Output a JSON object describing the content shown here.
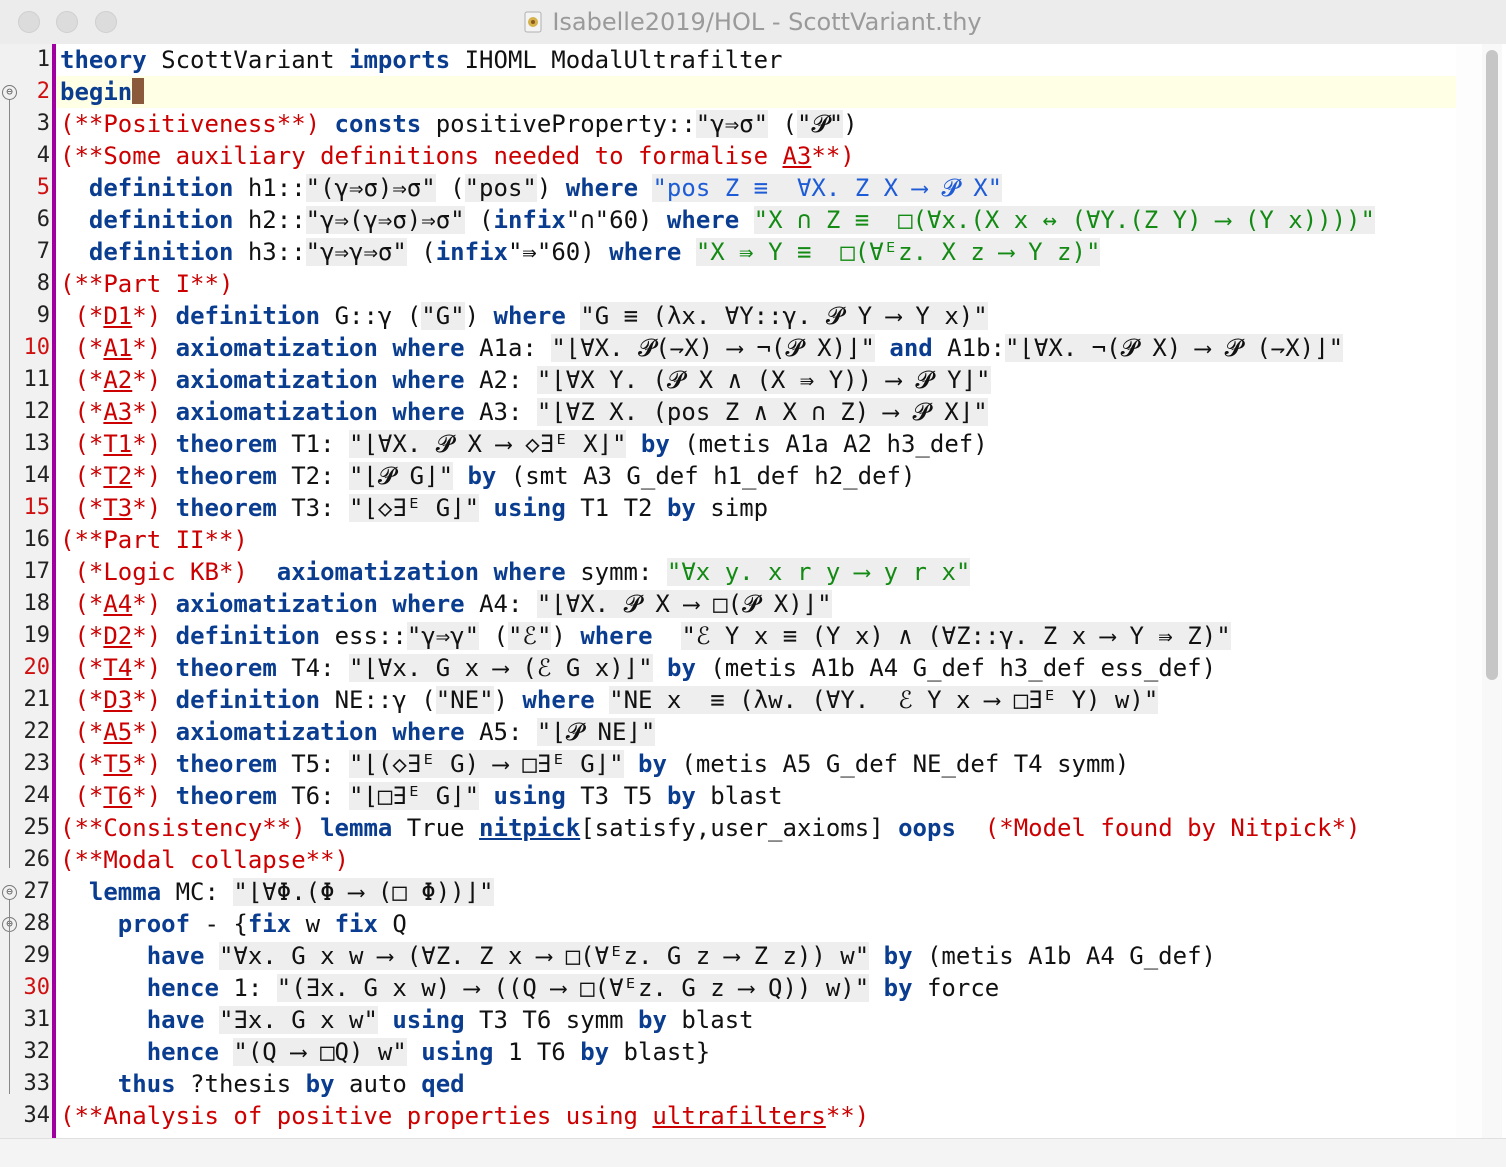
{
  "window": {
    "title": "Isabelle2019/HOL - ScottVariant.thy",
    "buttons": [
      "close",
      "minimize",
      "zoom"
    ]
  },
  "editor": {
    "current_line": 2,
    "lines": [
      {
        "n": "1",
        "segs": [
          [
            "theory",
            "kw"
          ],
          [
            " ScottVariant ",
            ""
          ],
          [
            "imports",
            "kw"
          ],
          [
            " IHOML ModalUltrafilter",
            ""
          ]
        ]
      },
      {
        "n": "2",
        "segs": [
          [
            "begin",
            "kw"
          ]
        ],
        "cursor": true,
        "hl": true,
        "fold": "⊖",
        "numRed": true
      },
      {
        "n": "3",
        "segs": [
          [
            "(**Positiveness**)",
            "cm"
          ],
          [
            " ",
            ""
          ],
          [
            "consts",
            "kw"
          ],
          [
            " positiveProperty::",
            ""
          ],
          [
            "\"γ⇒σ\"",
            "qs"
          ],
          [
            " (",
            ""
          ],
          [
            "\"𝓟\"",
            "qs"
          ],
          [
            ")",
            ""
          ]
        ]
      },
      {
        "n": "4",
        "segs": [
          [
            "(**Some auxiliary definitions needed to formalise ",
            "cm"
          ],
          [
            "A3",
            "cm ul"
          ],
          [
            "**)",
            "cm"
          ]
        ]
      },
      {
        "n": "5",
        "numRed": true,
        "segs": [
          [
            "  ",
            ""
          ],
          [
            "definition",
            "kw"
          ],
          [
            " h1::",
            ""
          ],
          [
            "\"(γ⇒σ)⇒σ\"",
            "qs"
          ],
          [
            " (",
            ""
          ],
          [
            "\"pos\"",
            "qs"
          ],
          [
            ") ",
            ""
          ],
          [
            "where",
            "kw"
          ],
          [
            " ",
            ""
          ],
          [
            "\"pos Z ≡  ∀X. Z X ⟶ 𝓟 X\"",
            "qs bl"
          ]
        ]
      },
      {
        "n": "6",
        "segs": [
          [
            "  ",
            ""
          ],
          [
            "definition",
            "kw"
          ],
          [
            " h2::",
            ""
          ],
          [
            "\"γ⇒(γ⇒σ)⇒σ\"",
            "qs"
          ],
          [
            " (",
            ""
          ],
          [
            "infix",
            "kw"
          ],
          [
            "\"∩\"60) ",
            ""
          ],
          [
            "where",
            "kw"
          ],
          [
            " ",
            ""
          ],
          [
            "\"X ∩ Z ≡  □(∀x.(X x ↔ (∀Y.(Z Y) ⟶ (Y x))))\"",
            "qs gr"
          ]
        ]
      },
      {
        "n": "7",
        "segs": [
          [
            "  ",
            ""
          ],
          [
            "definition",
            "kw"
          ],
          [
            " h3::",
            ""
          ],
          [
            "\"γ⇒γ⇒σ\"",
            "qs"
          ],
          [
            " (",
            ""
          ],
          [
            "infix",
            "kw"
          ],
          [
            "\"⇛\"60) ",
            ""
          ],
          [
            "where",
            "kw"
          ],
          [
            " ",
            ""
          ],
          [
            "\"X ⇛ Y ≡  □(∀ᴱz. X z ⟶ Y z)\"",
            "qs gr"
          ]
        ]
      },
      {
        "n": "8",
        "segs": [
          [
            "(**Part I**)",
            "cm"
          ]
        ]
      },
      {
        "n": "9",
        "segs": [
          [
            " (*",
            "cm"
          ],
          [
            "D1",
            "cm ul"
          ],
          [
            "*) ",
            "cm"
          ],
          [
            "definition",
            "kw"
          ],
          [
            " G::γ (",
            ""
          ],
          [
            "\"G\"",
            "qs"
          ],
          [
            ") ",
            ""
          ],
          [
            "where",
            "kw"
          ],
          [
            " ",
            ""
          ],
          [
            "\"G ≡ (λx. ∀Y::γ. 𝓟 Y ⟶ Y x)\"",
            "qs"
          ]
        ]
      },
      {
        "n": "10",
        "numRed": true,
        "segs": [
          [
            " (*",
            "cm"
          ],
          [
            "A1",
            "cm ul"
          ],
          [
            "*) ",
            "cm"
          ],
          [
            "axiomatization",
            "kw"
          ],
          [
            " ",
            ""
          ],
          [
            "where",
            "kw"
          ],
          [
            " A1a: ",
            ""
          ],
          [
            "\"⌊∀X. 𝓟(⇁X) ⟶ ¬(𝓟 X)⌋\"",
            "qs"
          ],
          [
            " ",
            ""
          ],
          [
            "and",
            "kw"
          ],
          [
            " A1b:",
            ""
          ],
          [
            "\"⌊∀X. ¬(𝓟 X) ⟶ 𝓟 (⇁X)⌋\"",
            "qs"
          ]
        ]
      },
      {
        "n": "11",
        "segs": [
          [
            " (*",
            "cm"
          ],
          [
            "A2",
            "cm ul"
          ],
          [
            "*) ",
            "cm"
          ],
          [
            "axiomatization",
            "kw"
          ],
          [
            " ",
            ""
          ],
          [
            "where",
            "kw"
          ],
          [
            " A2: ",
            ""
          ],
          [
            "\"⌊∀X Y. (𝓟 X ∧ (X ⇛ Y)) ⟶ 𝓟 Y⌋\"",
            "qs"
          ]
        ]
      },
      {
        "n": "12",
        "segs": [
          [
            " (*",
            "cm"
          ],
          [
            "A3",
            "cm ul"
          ],
          [
            "*) ",
            "cm"
          ],
          [
            "axiomatization",
            "kw"
          ],
          [
            " ",
            ""
          ],
          [
            "where",
            "kw"
          ],
          [
            " A3: ",
            ""
          ],
          [
            "\"⌊∀Z X. (pos Z ∧ X ∩ Z) ⟶ 𝓟 X⌋\"",
            "qs"
          ]
        ]
      },
      {
        "n": "13",
        "segs": [
          [
            " (*",
            "cm"
          ],
          [
            "T1",
            "cm ul"
          ],
          [
            "*) ",
            "cm"
          ],
          [
            "theorem",
            "kw"
          ],
          [
            " T1: ",
            ""
          ],
          [
            "\"⌊∀X. 𝓟 X ⟶ ◇∃ᴱ X⌋\"",
            "qs"
          ],
          [
            " ",
            ""
          ],
          [
            "by",
            "kw"
          ],
          [
            " (metis A1a A2 h3_def)",
            ""
          ]
        ]
      },
      {
        "n": "14",
        "segs": [
          [
            " (*",
            "cm"
          ],
          [
            "T2",
            "cm ul"
          ],
          [
            "*) ",
            "cm"
          ],
          [
            "theorem",
            "kw"
          ],
          [
            " T2: ",
            ""
          ],
          [
            "\"⌊𝓟 G⌋\"",
            "qs"
          ],
          [
            " ",
            ""
          ],
          [
            "by",
            "kw"
          ],
          [
            " (smt A3 G_def h1_def h2_def)",
            ""
          ]
        ]
      },
      {
        "n": "15",
        "numRed": true,
        "segs": [
          [
            " (*",
            "cm"
          ],
          [
            "T3",
            "cm ul"
          ],
          [
            "*) ",
            "cm"
          ],
          [
            "theorem",
            "kw"
          ],
          [
            " T3: ",
            ""
          ],
          [
            "\"⌊◇∃ᴱ G⌋\"",
            "qs"
          ],
          [
            " ",
            ""
          ],
          [
            "using",
            "kw"
          ],
          [
            " T1 T2 ",
            ""
          ],
          [
            "by",
            "kw"
          ],
          [
            " simp",
            ""
          ]
        ]
      },
      {
        "n": "16",
        "segs": [
          [
            "(**Part II**)",
            "cm"
          ]
        ]
      },
      {
        "n": "17",
        "segs": [
          [
            " (*Logic KB*)  ",
            "cm"
          ],
          [
            "axiomatization",
            "kw"
          ],
          [
            " ",
            ""
          ],
          [
            "where",
            "kw"
          ],
          [
            " symm: ",
            ""
          ],
          [
            "\"∀x y. x r y ⟶ y r x\"",
            "qs gr"
          ]
        ]
      },
      {
        "n": "18",
        "segs": [
          [
            " (*",
            "cm"
          ],
          [
            "A4",
            "cm ul"
          ],
          [
            "*) ",
            "cm"
          ],
          [
            "axiomatization",
            "kw"
          ],
          [
            " ",
            ""
          ],
          [
            "where",
            "kw"
          ],
          [
            " A4: ",
            ""
          ],
          [
            "\"⌊∀X. 𝓟 X ⟶ □(𝓟 X)⌋\"",
            "qs"
          ]
        ]
      },
      {
        "n": "19",
        "segs": [
          [
            " (*",
            "cm"
          ],
          [
            "D2",
            "cm ul"
          ],
          [
            "*) ",
            "cm"
          ],
          [
            "definition",
            "kw"
          ],
          [
            " ess::",
            ""
          ],
          [
            "\"γ⇒γ\"",
            "qs"
          ],
          [
            " (",
            ""
          ],
          [
            "\"ℰ\"",
            "qs"
          ],
          [
            ") ",
            ""
          ],
          [
            "where",
            "kw"
          ],
          [
            "  ",
            ""
          ],
          [
            "\"ℰ Y x ≡ (Y x) ∧ (∀Z::γ. Z x ⟶ Y ⇛ Z)\"",
            "qs"
          ]
        ]
      },
      {
        "n": "20",
        "numRed": true,
        "segs": [
          [
            " (*",
            "cm"
          ],
          [
            "T4",
            "cm ul"
          ],
          [
            "*) ",
            "cm"
          ],
          [
            "theorem",
            "kw"
          ],
          [
            " T4: ",
            ""
          ],
          [
            "\"⌊∀x. G x ⟶ (ℰ G x)⌋\"",
            "qs"
          ],
          [
            " ",
            ""
          ],
          [
            "by",
            "kw"
          ],
          [
            " (metis A1b A4 G_def h3_def ess_def)",
            ""
          ]
        ]
      },
      {
        "n": "21",
        "segs": [
          [
            " (*",
            "cm"
          ],
          [
            "D3",
            "cm ul"
          ],
          [
            "*) ",
            "cm"
          ],
          [
            "definition",
            "kw"
          ],
          [
            " NE::γ (",
            ""
          ],
          [
            "\"NE\"",
            "qs"
          ],
          [
            ") ",
            ""
          ],
          [
            "where",
            "kw"
          ],
          [
            " ",
            ""
          ],
          [
            "\"NE x  ≡ (λw. (∀Y.  ℰ Y x ⟶ □∃ᴱ Y) w)\"",
            "qs"
          ]
        ]
      },
      {
        "n": "22",
        "segs": [
          [
            " (*",
            "cm"
          ],
          [
            "A5",
            "cm ul"
          ],
          [
            "*) ",
            "cm"
          ],
          [
            "axiomatization",
            "kw"
          ],
          [
            " ",
            ""
          ],
          [
            "where",
            "kw"
          ],
          [
            " A5: ",
            ""
          ],
          [
            "\"⌊𝓟 NE⌋\"",
            "qs"
          ]
        ]
      },
      {
        "n": "23",
        "segs": [
          [
            " (*",
            "cm"
          ],
          [
            "T5",
            "cm ul"
          ],
          [
            "*) ",
            "cm"
          ],
          [
            "theorem",
            "kw"
          ],
          [
            " T5: ",
            ""
          ],
          [
            "\"⌊(◇∃ᴱ G) ⟶ □∃ᴱ G⌋\"",
            "qs"
          ],
          [
            " ",
            ""
          ],
          [
            "by",
            "kw"
          ],
          [
            " (metis A5 G_def NE_def T4 symm)",
            ""
          ]
        ]
      },
      {
        "n": "24",
        "segs": [
          [
            " (*",
            "cm"
          ],
          [
            "T6",
            "cm ul"
          ],
          [
            "*) ",
            "cm"
          ],
          [
            "theorem",
            "kw"
          ],
          [
            " T6: ",
            ""
          ],
          [
            "\"⌊□∃ᴱ G⌋\"",
            "qs"
          ],
          [
            " ",
            ""
          ],
          [
            "using",
            "kw"
          ],
          [
            " T3 T5 ",
            ""
          ],
          [
            "by",
            "kw"
          ],
          [
            " blast",
            ""
          ]
        ]
      },
      {
        "n": "25",
        "segs": [
          [
            "(**Consistency**) ",
            "cm"
          ],
          [
            "lemma",
            "kw"
          ],
          [
            " True ",
            ""
          ],
          [
            "nitpick",
            "kw ul"
          ],
          [
            "[satisfy,user_axioms] ",
            ""
          ],
          [
            "oops",
            "kw"
          ],
          [
            "  ",
            ""
          ],
          [
            "(*Model found by Nitpick*)",
            "cm"
          ]
        ]
      },
      {
        "n": "26",
        "segs": [
          [
            "(**Modal collapse**)",
            "cm"
          ]
        ]
      },
      {
        "n": "27",
        "fold": "⊖",
        "segs": [
          [
            "  ",
            ""
          ],
          [
            "lemma",
            "kw"
          ],
          [
            " MC: ",
            ""
          ],
          [
            "\"⌊∀Φ.(Φ ⟶ (□ Φ))⌋\"",
            "qs"
          ]
        ]
      },
      {
        "n": "28",
        "fold": "⊖",
        "segs": [
          [
            "    ",
            ""
          ],
          [
            "proof",
            "kw"
          ],
          [
            " - {",
            ""
          ],
          [
            "fix",
            "kw"
          ],
          [
            " w ",
            ""
          ],
          [
            "fix",
            "kw"
          ],
          [
            " Q",
            ""
          ]
        ]
      },
      {
        "n": "29",
        "segs": [
          [
            "      ",
            ""
          ],
          [
            "have",
            "kw"
          ],
          [
            " ",
            ""
          ],
          [
            "\"∀x. G x w ⟶ (∀Z. Z x ⟶ □(∀ᴱz. G z ⟶ Z z)) w\"",
            "qs"
          ],
          [
            " ",
            ""
          ],
          [
            "by",
            "kw"
          ],
          [
            " (metis A1b A4 G_def)",
            ""
          ]
        ]
      },
      {
        "n": "30",
        "numRed": true,
        "segs": [
          [
            "      ",
            ""
          ],
          [
            "hence",
            "kw"
          ],
          [
            " 1: ",
            ""
          ],
          [
            "\"(∃x. G x w) ⟶ ((Q ⟶ □(∀ᴱz. G z ⟶ Q)) w)\"",
            "qs"
          ],
          [
            " ",
            ""
          ],
          [
            "by",
            "kw"
          ],
          [
            " force",
            ""
          ]
        ]
      },
      {
        "n": "31",
        "segs": [
          [
            "      ",
            ""
          ],
          [
            "have",
            "kw"
          ],
          [
            " ",
            ""
          ],
          [
            "\"∃x. G x w\"",
            "qs"
          ],
          [
            " ",
            ""
          ],
          [
            "using",
            "kw"
          ],
          [
            " T3 T6 symm ",
            ""
          ],
          [
            "by",
            "kw"
          ],
          [
            " blast",
            ""
          ]
        ]
      },
      {
        "n": "32",
        "segs": [
          [
            "      ",
            ""
          ],
          [
            "hence",
            "kw"
          ],
          [
            " ",
            ""
          ],
          [
            "\"(Q ⟶ □Q) w\"",
            "qs"
          ],
          [
            " ",
            ""
          ],
          [
            "using",
            "kw"
          ],
          [
            " 1 T6 ",
            ""
          ],
          [
            "by",
            "kw"
          ],
          [
            " blast}",
            ""
          ]
        ]
      },
      {
        "n": "33",
        "segs": [
          [
            "    ",
            ""
          ],
          [
            "thus",
            "kw"
          ],
          [
            " ?thesis ",
            ""
          ],
          [
            "by",
            "kw"
          ],
          [
            " auto ",
            ""
          ],
          [
            "qed",
            "kw"
          ]
        ]
      },
      {
        "n": "34",
        "segs": [
          [
            "(**Analysis of positive properties using ",
            "cm"
          ],
          [
            "ultrafilters",
            "cm ul"
          ],
          [
            "**)",
            "cm"
          ]
        ]
      }
    ]
  }
}
